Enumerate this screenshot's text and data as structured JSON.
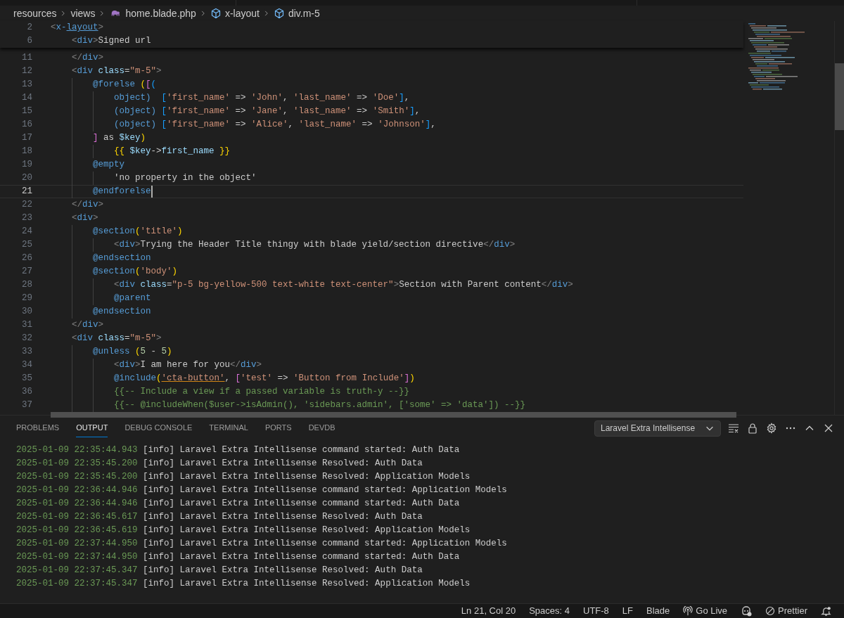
{
  "breadcrumb": [
    {
      "kind": "folder",
      "label": "resources"
    },
    {
      "kind": "folder",
      "label": "views"
    },
    {
      "kind": "file",
      "label": "home.blade.php"
    },
    {
      "kind": "symbol",
      "label": "x-layout"
    },
    {
      "kind": "symbol",
      "label": "div.m-5"
    }
  ],
  "sticky_lines": [
    {
      "number": "2",
      "tokens": [
        {
          "kind": "punct",
          "text": "<"
        },
        {
          "kind": "tag",
          "text": "x-"
        },
        {
          "kind": "link",
          "text": "layout"
        },
        {
          "kind": "punct",
          "text": ">"
        }
      ]
    },
    {
      "number": "6",
      "tokens": [
        {
          "kind": "punct",
          "text": "    <"
        },
        {
          "kind": "tag",
          "text": "div"
        },
        {
          "kind": "punct",
          "text": ">"
        },
        {
          "kind": "text",
          "text": "Signed url"
        }
      ]
    }
  ],
  "lines": [
    {
      "number": "11",
      "current": false,
      "tokens": [
        {
          "kind": "punct",
          "text": "    </"
        },
        {
          "kind": "tag",
          "text": "div"
        },
        {
          "kind": "punct",
          "text": ">"
        }
      ]
    },
    {
      "number": "12",
      "current": false,
      "tokens": [
        {
          "kind": "punct",
          "text": "    <"
        },
        {
          "kind": "tag",
          "text": "div"
        },
        {
          "kind": "attr",
          "text": " class"
        },
        {
          "kind": "text",
          "text": "="
        },
        {
          "kind": "str",
          "text": "\"m-5\""
        },
        {
          "kind": "punct",
          "text": ">"
        }
      ]
    },
    {
      "number": "13",
      "current": false,
      "tokens": [
        {
          "kind": "dir",
          "text": "        @forelse"
        },
        {
          "kind": "b1",
          "text": " ("
        },
        {
          "kind": "b2",
          "text": "["
        },
        {
          "kind": "b3",
          "text": "("
        }
      ]
    },
    {
      "number": "14",
      "current": false,
      "tokens": [
        {
          "kind": "kw",
          "text": "            object)"
        },
        {
          "kind": "b3",
          "text": "  ["
        },
        {
          "kind": "str",
          "text": "'first_name'"
        },
        {
          "kind": "text",
          "text": " => "
        },
        {
          "kind": "str",
          "text": "'John'"
        },
        {
          "kind": "text",
          "text": ", "
        },
        {
          "kind": "str",
          "text": "'last_name'"
        },
        {
          "kind": "text",
          "text": " => "
        },
        {
          "kind": "str",
          "text": "'Doe'"
        },
        {
          "kind": "b3",
          "text": "]"
        },
        {
          "kind": "text",
          "text": ","
        }
      ]
    },
    {
      "number": "15",
      "current": false,
      "tokens": [
        {
          "kind": "kw",
          "text": "            (object)"
        },
        {
          "kind": "b3",
          "text": " ["
        },
        {
          "kind": "str",
          "text": "'first_name'"
        },
        {
          "kind": "text",
          "text": " => "
        },
        {
          "kind": "str",
          "text": "'Jane'"
        },
        {
          "kind": "text",
          "text": ", "
        },
        {
          "kind": "str",
          "text": "'last_name'"
        },
        {
          "kind": "text",
          "text": " => "
        },
        {
          "kind": "str",
          "text": "'Smith'"
        },
        {
          "kind": "b3",
          "text": "]"
        },
        {
          "kind": "text",
          "text": ","
        }
      ]
    },
    {
      "number": "16",
      "current": false,
      "tokens": [
        {
          "kind": "kw",
          "text": "            (object)"
        },
        {
          "kind": "b3",
          "text": " ["
        },
        {
          "kind": "str",
          "text": "'first_name'"
        },
        {
          "kind": "text",
          "text": " => "
        },
        {
          "kind": "str",
          "text": "'Alice'"
        },
        {
          "kind": "text",
          "text": ", "
        },
        {
          "kind": "str",
          "text": "'last_name'"
        },
        {
          "kind": "text",
          "text": " => "
        },
        {
          "kind": "str",
          "text": "'Johnson'"
        },
        {
          "kind": "b3",
          "text": "]"
        },
        {
          "kind": "text",
          "text": ","
        }
      ]
    },
    {
      "number": "17",
      "current": false,
      "tokens": [
        {
          "kind": "b2",
          "text": "        ]"
        },
        {
          "kind": "text",
          "text": " as "
        },
        {
          "kind": "var",
          "text": "$key"
        },
        {
          "kind": "b1",
          "text": ")"
        }
      ]
    },
    {
      "number": "18",
      "current": false,
      "tokens": [
        {
          "kind": "b1",
          "text": "            {{"
        },
        {
          "kind": "var",
          "text": " $key"
        },
        {
          "kind": "text",
          "text": "->"
        },
        {
          "kind": "var",
          "text": "first_name"
        },
        {
          "kind": "b1",
          "text": " }}"
        }
      ]
    },
    {
      "number": "19",
      "current": false,
      "tokens": [
        {
          "kind": "dir",
          "text": "        @empty"
        }
      ]
    },
    {
      "number": "20",
      "current": false,
      "tokens": [
        {
          "kind": "text",
          "text": "            'no property in the object'"
        }
      ]
    },
    {
      "number": "21",
      "current": true,
      "tokens": [
        {
          "kind": "dir",
          "text": "        @endforelse"
        }
      ]
    },
    {
      "number": "22",
      "current": false,
      "tokens": [
        {
          "kind": "punct",
          "text": "    </"
        },
        {
          "kind": "tag",
          "text": "div"
        },
        {
          "kind": "punct",
          "text": ">"
        }
      ]
    },
    {
      "number": "23",
      "current": false,
      "tokens": [
        {
          "kind": "punct",
          "text": "    <"
        },
        {
          "kind": "tag",
          "text": "div"
        },
        {
          "kind": "punct",
          "text": ">"
        }
      ]
    },
    {
      "number": "24",
      "current": false,
      "tokens": [
        {
          "kind": "dir",
          "text": "        @section"
        },
        {
          "kind": "b1",
          "text": "("
        },
        {
          "kind": "str",
          "text": "'title'"
        },
        {
          "kind": "b1",
          "text": ")"
        }
      ]
    },
    {
      "number": "25",
      "current": false,
      "tokens": [
        {
          "kind": "punct",
          "text": "            <"
        },
        {
          "kind": "tag",
          "text": "div"
        },
        {
          "kind": "punct",
          "text": ">"
        },
        {
          "kind": "text",
          "text": "Trying the Header Title thingy with blade yield/section directive"
        },
        {
          "kind": "punct",
          "text": "</"
        },
        {
          "kind": "tag",
          "text": "div"
        },
        {
          "kind": "punct",
          "text": ">"
        }
      ]
    },
    {
      "number": "26",
      "current": false,
      "tokens": [
        {
          "kind": "dir",
          "text": "        @endsection"
        }
      ]
    },
    {
      "number": "27",
      "current": false,
      "tokens": [
        {
          "kind": "dir",
          "text": "        @section"
        },
        {
          "kind": "b1",
          "text": "("
        },
        {
          "kind": "str",
          "text": "'body'"
        },
        {
          "kind": "b1",
          "text": ")"
        }
      ]
    },
    {
      "number": "28",
      "current": false,
      "tokens": [
        {
          "kind": "punct",
          "text": "            <"
        },
        {
          "kind": "tag",
          "text": "div"
        },
        {
          "kind": "attr",
          "text": " class"
        },
        {
          "kind": "text",
          "text": "="
        },
        {
          "kind": "str",
          "text": "\"p-5 bg-yellow-500 text-white text-center\""
        },
        {
          "kind": "punct",
          "text": ">"
        },
        {
          "kind": "text",
          "text": "Section with Parent content"
        },
        {
          "kind": "punct",
          "text": "</"
        },
        {
          "kind": "tag",
          "text": "div"
        },
        {
          "kind": "punct",
          "text": ">"
        }
      ]
    },
    {
      "number": "29",
      "current": false,
      "tokens": [
        {
          "kind": "dir",
          "text": "            @parent"
        }
      ]
    },
    {
      "number": "30",
      "current": false,
      "tokens": [
        {
          "kind": "dir",
          "text": "        @endsection"
        }
      ]
    },
    {
      "number": "31",
      "current": false,
      "tokens": [
        {
          "kind": "punct",
          "text": "    </"
        },
        {
          "kind": "tag",
          "text": "div"
        },
        {
          "kind": "punct",
          "text": ">"
        }
      ]
    },
    {
      "number": "32",
      "current": false,
      "tokens": [
        {
          "kind": "punct",
          "text": "    <"
        },
        {
          "kind": "tag",
          "text": "div"
        },
        {
          "kind": "attr",
          "text": " class"
        },
        {
          "kind": "text",
          "text": "="
        },
        {
          "kind": "str",
          "text": "\"m-5\""
        },
        {
          "kind": "punct",
          "text": ">"
        }
      ]
    },
    {
      "number": "33",
      "current": false,
      "tokens": [
        {
          "kind": "dir",
          "text": "        @unless"
        },
        {
          "kind": "b1",
          "text": " ("
        },
        {
          "kind": "num",
          "text": "5"
        },
        {
          "kind": "text",
          "text": " - "
        },
        {
          "kind": "num",
          "text": "5"
        },
        {
          "kind": "b1",
          "text": ")"
        }
      ]
    },
    {
      "number": "34",
      "current": false,
      "tokens": [
        {
          "kind": "punct",
          "text": "            <"
        },
        {
          "kind": "tag",
          "text": "div"
        },
        {
          "kind": "punct",
          "text": ">"
        },
        {
          "kind": "text",
          "text": "I am here for you"
        },
        {
          "kind": "punct",
          "text": "</"
        },
        {
          "kind": "tag",
          "text": "div"
        },
        {
          "kind": "punct",
          "text": ">"
        }
      ]
    },
    {
      "number": "35",
      "current": false,
      "tokens": [
        {
          "kind": "dir",
          "text": "            @include"
        },
        {
          "kind": "b1",
          "text": "("
        },
        {
          "kind": "warn",
          "text": "'cta-button'"
        },
        {
          "kind": "text",
          "text": ", "
        },
        {
          "kind": "b2",
          "text": "["
        },
        {
          "kind": "str",
          "text": "'test'"
        },
        {
          "kind": "text",
          "text": " => "
        },
        {
          "kind": "str",
          "text": "'Button from Include'"
        },
        {
          "kind": "b2",
          "text": "]"
        },
        {
          "kind": "b1",
          "text": ")"
        }
      ]
    },
    {
      "number": "36",
      "current": false,
      "tokens": [
        {
          "kind": "comment",
          "text": "            {{-- Include a view if a passed variable is truth-y --}}"
        }
      ]
    },
    {
      "number": "37",
      "current": false,
      "tokens": [
        {
          "kind": "comment",
          "text": "            {{-- @includeWhen($user->isAdmin(), 'sidebars.admin', ['some' => 'data']) --}}"
        }
      ]
    }
  ],
  "panel": {
    "tabs": [
      {
        "label": "PROBLEMS",
        "selected": false
      },
      {
        "label": "OUTPUT",
        "selected": true
      },
      {
        "label": "DEBUG CONSOLE",
        "selected": false
      },
      {
        "label": "TERMINAL",
        "selected": false
      },
      {
        "label": "PORTS",
        "selected": false
      },
      {
        "label": "DEVDB",
        "selected": false
      }
    ],
    "channel": "Laravel Extra Intellisense",
    "log": [
      {
        "time": "2025-01-09 22:35:44.943",
        "level": "[info]",
        "message": "Laravel Extra Intellisense command started: Auth Data"
      },
      {
        "time": "2025-01-09 22:35:45.200",
        "level": "[info]",
        "message": "Laravel Extra Intellisense Resolved: Auth Data"
      },
      {
        "time": "2025-01-09 22:35:45.200",
        "level": "[info]",
        "message": "Laravel Extra Intellisense Resolved: Application Models"
      },
      {
        "time": "2025-01-09 22:36:44.946",
        "level": "[info]",
        "message": "Laravel Extra Intellisense command started: Application Models"
      },
      {
        "time": "2025-01-09 22:36:44.946",
        "level": "[info]",
        "message": "Laravel Extra Intellisense command started: Auth Data"
      },
      {
        "time": "2025-01-09 22:36:45.617",
        "level": "[info]",
        "message": "Laravel Extra Intellisense Resolved: Auth Data"
      },
      {
        "time": "2025-01-09 22:36:45.619",
        "level": "[info]",
        "message": "Laravel Extra Intellisense Resolved: Application Models"
      },
      {
        "time": "2025-01-09 22:37:44.950",
        "level": "[info]",
        "message": "Laravel Extra Intellisense command started: Application Models"
      },
      {
        "time": "2025-01-09 22:37:44.950",
        "level": "[info]",
        "message": "Laravel Extra Intellisense command started: Auth Data"
      },
      {
        "time": "2025-01-09 22:37:45.347",
        "level": "[info]",
        "message": "Laravel Extra Intellisense Resolved: Auth Data"
      },
      {
        "time": "2025-01-09 22:37:45.347",
        "level": "[info]",
        "message": "Laravel Extra Intellisense Resolved: Application Models"
      }
    ]
  },
  "status_bar": [
    {
      "kind": "text",
      "label": "Ln 21, Col 20"
    },
    {
      "kind": "text",
      "label": "Spaces: 4"
    },
    {
      "kind": "text",
      "label": "UTF-8"
    },
    {
      "kind": "text",
      "label": "LF"
    },
    {
      "kind": "text",
      "label": "Blade"
    },
    {
      "kind": "golive",
      "label": "Go Live"
    },
    {
      "kind": "copilot"
    },
    {
      "kind": "prettier",
      "label": "Prettier"
    },
    {
      "kind": "bell"
    }
  ]
}
